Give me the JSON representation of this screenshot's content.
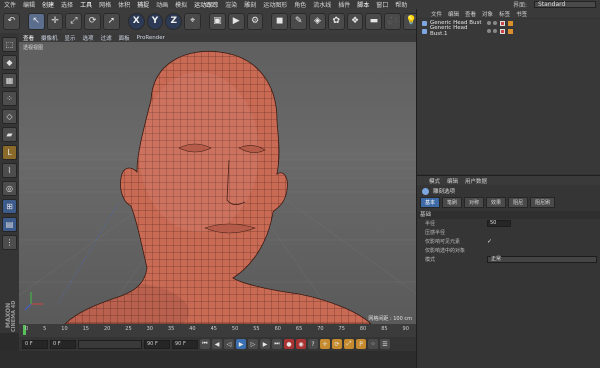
{
  "menubar": {
    "items": [
      "文件",
      "编辑",
      "创建",
      "选择",
      "工具",
      "网格",
      "体积",
      "捕捉",
      "动画",
      "模拟",
      "运动跟踪",
      "渲染",
      "雕刻",
      "运动图形",
      "角色",
      "流水线",
      "插件",
      "脚本",
      "窗口",
      "帮助"
    ],
    "layout_label": "界面:",
    "layout_value": "Standard"
  },
  "toolbar": {
    "buttons": [
      {
        "name": "undo-icon",
        "glyph": "↶"
      },
      {
        "name": "cursor-select-icon",
        "glyph": "↖"
      },
      {
        "name": "move-icon",
        "glyph": "✛"
      },
      {
        "name": "scale-icon",
        "glyph": "⤢"
      },
      {
        "name": "rotate-icon",
        "glyph": "⟳"
      },
      {
        "name": "live-select-icon",
        "glyph": "➚"
      },
      {
        "name": "x-axis-icon",
        "glyph": "X"
      },
      {
        "name": "y-axis-icon",
        "glyph": "Y"
      },
      {
        "name": "z-axis-icon",
        "glyph": "Z"
      },
      {
        "name": "coordinate-system-icon",
        "glyph": "⌖"
      },
      {
        "name": "render-view-icon",
        "glyph": "▣"
      },
      {
        "name": "render-to-picture-viewer-icon",
        "glyph": "▶"
      },
      {
        "name": "render-settings-icon",
        "glyph": "⚙"
      },
      {
        "name": "cube-icon",
        "glyph": "◼"
      },
      {
        "name": "pen-icon",
        "glyph": "✎"
      },
      {
        "name": "subdivision-icon",
        "glyph": "◈"
      },
      {
        "name": "array-icon",
        "glyph": "✿"
      },
      {
        "name": "deformer-icon",
        "glyph": "❖"
      },
      {
        "name": "floor-icon",
        "glyph": "▬"
      },
      {
        "name": "camera-icon",
        "glyph": "🎥"
      },
      {
        "name": "light-icon",
        "glyph": "💡"
      }
    ]
  },
  "lefttools": {
    "buttons": [
      {
        "name": "make-editable-icon",
        "glyph": "⬚"
      },
      {
        "name": "model-mode-icon",
        "glyph": "◆"
      },
      {
        "name": "texture-mode-icon",
        "glyph": "▦"
      },
      {
        "name": "points-mode-icon",
        "glyph": "⁘"
      },
      {
        "name": "edges-mode-icon",
        "glyph": "◇"
      },
      {
        "name": "polygons-mode-icon",
        "glyph": "▰"
      },
      {
        "name": "axis-mode-icon",
        "glyph": "L"
      },
      {
        "name": "tweak-mode-icon",
        "glyph": "⌇"
      },
      {
        "name": "snap-icon",
        "glyph": "◎"
      },
      {
        "name": "workplane-icon",
        "glyph": "⊞"
      },
      {
        "name": "lock-workplane-icon",
        "glyph": "▤"
      },
      {
        "name": "grid-icon",
        "glyph": "⋮"
      }
    ]
  },
  "viewport": {
    "menu": [
      "查看",
      "摄像机",
      "显示",
      "选项",
      "过滤",
      "面板",
      "ProRender"
    ],
    "label": "透视视图",
    "footer": "网格间距 : 100 cm"
  },
  "timeline": {
    "ticks": [
      "0",
      "5",
      "10",
      "15",
      "20",
      "25",
      "30",
      "35",
      "40",
      "45",
      "50",
      "55",
      "60",
      "65",
      "70",
      "75",
      "80",
      "85",
      "90"
    ],
    "current_frame": "0 F",
    "start_frame": "0 F",
    "end_frame": "90 F",
    "max_frame": "90 F"
  },
  "transport": {
    "buttons": [
      {
        "name": "go-to-start-icon",
        "glyph": "⏮",
        "cls": ""
      },
      {
        "name": "previous-key-icon",
        "glyph": "◀",
        "cls": ""
      },
      {
        "name": "previous-frame-icon",
        "glyph": "◁",
        "cls": ""
      },
      {
        "name": "play-forward-icon",
        "glyph": "▶",
        "cls": "play"
      },
      {
        "name": "next-frame-icon",
        "glyph": "▷",
        "cls": ""
      },
      {
        "name": "next-key-icon",
        "glyph": "▶",
        "cls": ""
      },
      {
        "name": "go-to-end-icon",
        "glyph": "⏭",
        "cls": ""
      },
      {
        "name": "record-icon",
        "glyph": "●",
        "cls": "rec"
      },
      {
        "name": "autokey-icon",
        "glyph": "◉",
        "cls": "rec"
      },
      {
        "name": "keyframe-selection-icon",
        "glyph": "?",
        "cls": ""
      },
      {
        "name": "move-key-icon",
        "glyph": "✛",
        "cls": "key"
      },
      {
        "name": "rotate-key-icon",
        "glyph": "⟳",
        "cls": "key"
      },
      {
        "name": "scale-key-icon",
        "glyph": "⤢",
        "cls": "key"
      },
      {
        "name": "param-key-icon",
        "glyph": "P",
        "cls": "key"
      },
      {
        "name": "point-level-icon",
        "glyph": "⁘",
        "cls": ""
      },
      {
        "name": "timeline-menu-icon",
        "glyph": "☰",
        "cls": ""
      }
    ]
  },
  "logo": {
    "line1": "MAXON",
    "line2": "CINEMA 4D"
  },
  "object_manager": {
    "menu": [
      "文件",
      "编辑",
      "查看",
      "对象",
      "标签",
      "书签"
    ],
    "objects": [
      {
        "name": "Generic Head Bust"
      },
      {
        "name": "Generic Head Bust.1"
      }
    ]
  },
  "attribute_manager": {
    "menu": [
      "模式",
      "编辑",
      "用户数据"
    ],
    "title": "雕刻选项",
    "tabs": [
      "基本",
      "笔刷",
      "对称",
      "效果",
      "阻尼",
      "阻尼刷"
    ],
    "active_tab": 0,
    "section": "基础",
    "props": [
      {
        "label": "半径",
        "value": "50",
        "kind": "value"
      },
      {
        "label": "压感半径",
        "value": "",
        "kind": "check"
      },
      {
        "label": "仅影响可见元素",
        "value": "✓",
        "kind": "check"
      },
      {
        "label": "仅影响选中的对象",
        "value": "",
        "kind": "check"
      },
      {
        "label": "模式",
        "value": "正常",
        "kind": "drop"
      }
    ]
  },
  "colors": {
    "mesh": "#c96a55",
    "wire": "#4a2219",
    "accent": "#3e6aa6"
  }
}
